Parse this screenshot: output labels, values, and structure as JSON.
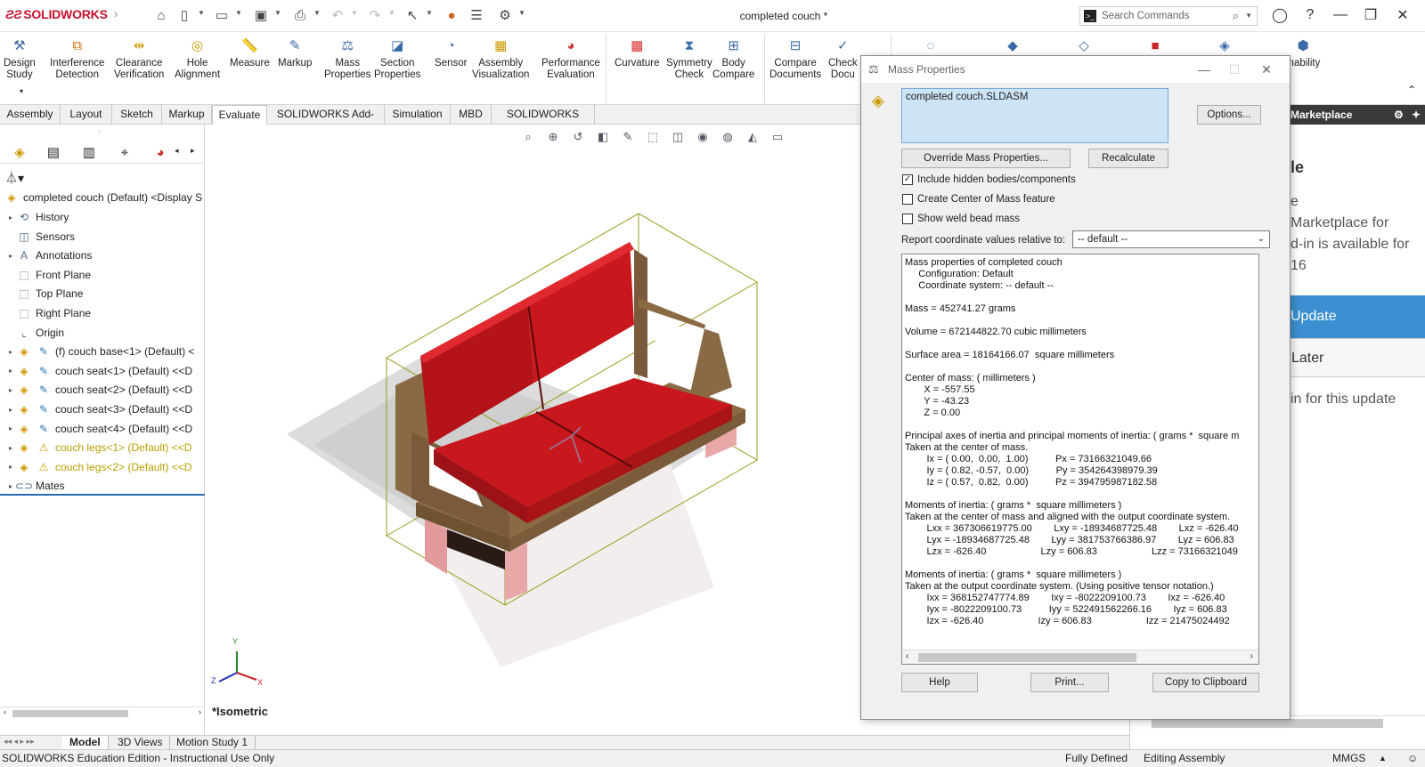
{
  "app": {
    "logo": "SOLIDWORKS",
    "doc_title": "completed couch *"
  },
  "search": {
    "placeholder": "Search Commands"
  },
  "toolbar": {
    "tools": [
      {
        "name": "design-study",
        "label": "Design\nStudy",
        "icon": "tool-icon"
      },
      {
        "name": "interference",
        "label": "Interference\nDetection",
        "icon": "interference-icon"
      },
      {
        "name": "clearance",
        "label": "Clearance\nVerification",
        "icon": "clearance-icon"
      },
      {
        "name": "hole-alignment",
        "label": "Hole\nAlignment",
        "icon": "hole-icon"
      },
      {
        "name": "measure",
        "label": "Measure",
        "icon": "measure-icon"
      },
      {
        "name": "markup",
        "label": "Markup",
        "icon": "markup-icon"
      },
      {
        "name": "mass-properties",
        "label": "Mass\nProperties",
        "icon": "scale-icon"
      },
      {
        "name": "section-properties",
        "label": "Section\nProperties",
        "icon": "section-icon"
      },
      {
        "name": "sensor",
        "label": "Sensor",
        "icon": "sensor-icon"
      },
      {
        "name": "assembly-visualization",
        "label": "Assembly\nVisualization",
        "icon": "assembly-icon"
      },
      {
        "name": "performance-evaluation",
        "label": "Performance\nEvaluation",
        "icon": "performance-icon"
      },
      {
        "name": "curvature",
        "label": "Curvature",
        "icon": "curvature-icon"
      },
      {
        "name": "symmetry-check",
        "label": "Symmetry\nCheck",
        "icon": "symmetry-icon"
      },
      {
        "name": "body-compare",
        "label": "Body\nCompare",
        "icon": "compare-icon"
      },
      {
        "name": "compare-documents",
        "label": "Compare\nDocuments",
        "icon": "documents-icon"
      },
      {
        "name": "check-documents",
        "label": "Check\nDocu",
        "icon": "check-icon"
      }
    ],
    "sustainability": "inability"
  },
  "tabs": [
    "Assembly",
    "Layout",
    "Sketch",
    "Markup",
    "Evaluate",
    "SOLIDWORKS Add-Ins",
    "Simulation",
    "MBD",
    "SOLIDWORKS CAM"
  ],
  "active_tab": "Evaluate",
  "tree": {
    "root": "completed couch (Default) <Display S",
    "items": [
      {
        "label": "History",
        "exp": true,
        "icon": "history-icon"
      },
      {
        "label": "Sensors",
        "exp": false,
        "icon": "sensors-icon"
      },
      {
        "label": "Annotations",
        "exp": true,
        "icon": "annotations-icon"
      },
      {
        "label": "Front Plane",
        "exp": false,
        "icon": "plane-icon"
      },
      {
        "label": "Top Plane",
        "exp": false,
        "icon": "plane-icon"
      },
      {
        "label": "Right Plane",
        "exp": false,
        "icon": "plane-icon"
      },
      {
        "label": "Origin",
        "exp": false,
        "icon": "origin-icon"
      },
      {
        "label": "(f) couch base<1> (Default) <",
        "exp": true,
        "icon": "part-icon",
        "warn": false
      },
      {
        "label": "couch seat<1> (Default) <<D",
        "exp": true,
        "icon": "part-icon",
        "warn": false
      },
      {
        "label": "couch seat<2> (Default) <<D",
        "exp": true,
        "icon": "part-icon",
        "warn": false
      },
      {
        "label": "couch seat<3> (Default) <<D",
        "exp": true,
        "icon": "part-icon",
        "warn": false
      },
      {
        "label": "couch seat<4> (Default) <<D",
        "exp": true,
        "icon": "part-icon",
        "warn": false
      },
      {
        "label": "couch legs<1> (Default) <<D",
        "exp": true,
        "icon": "warning-icon",
        "warn": true
      },
      {
        "label": "couch legs<2> (Default) <<D",
        "exp": true,
        "icon": "warning-icon",
        "warn": true
      },
      {
        "label": "Mates",
        "exp": true,
        "icon": "mates-icon"
      }
    ]
  },
  "viewport": {
    "view_label": "*Isometric",
    "triad": {
      "x": "X",
      "y": "Y",
      "z": "Z"
    }
  },
  "bottom_tabs": [
    "Model",
    "3D Views",
    "Motion Study 1"
  ],
  "status": {
    "edition": "SOLIDWORKS Education Edition - Instructional Use Only",
    "state": "Fully Defined",
    "mode": "Editing Assembly",
    "units": "MMGS"
  },
  "taskpane": {
    "title": "Marketplace",
    "lines": [
      "le",
      "e",
      "Marketplace for",
      "d-in is available for",
      "16"
    ],
    "update": "Update",
    "later": "Later",
    "footer": "in for this update"
  },
  "dialog": {
    "title": "Mass Properties",
    "selection": "completed couch.SLDASM",
    "options_btn": "Options...",
    "override_btn": "Override Mass Properties...",
    "recalculate_btn": "Recalculate",
    "checks": [
      {
        "label": "Include hidden bodies/components",
        "checked": "✓"
      },
      {
        "label": "Create Center of Mass feature",
        "checked": ""
      },
      {
        "label": "Show weld bead mass",
        "checked": ""
      }
    ],
    "coord_label": "Report coordinate values relative to:",
    "coord_value": "-- default --",
    "results": "Mass properties of completed couch\n     Configuration: Default\n     Coordinate system: -- default --\n\nMass = 452741.27 grams\n\nVolume = 672144822.70 cubic millimeters\n\nSurface area = 18164166.07  square millimeters\n\nCenter of mass: ( millimeters )\n       X = -557.55\n       Y = -43.23\n       Z = 0.00\n\nPrincipal axes of inertia and principal moments of inertia: ( grams *  square m\nTaken at the center of mass.\n        Ix = ( 0.00,  0.00,  1.00)          Px = 73166321049.66\n        Iy = ( 0.82, -0.57,  0.00)          Py = 354264398979.39\n        Iz = ( 0.57,  0.82,  0.00)          Pz = 394795987182.58\n\nMoments of inertia: ( grams *  square millimeters )\nTaken at the center of mass and aligned with the output coordinate system.\n        Lxx = 367306619775.00        Lxy = -18934687725.48        Lxz = -626.40\n        Lyx = -18934687725.48        Lyy = 381753766386.97        Lyz = 606.83\n        Lzx = -626.40                    Lzy = 606.83                    Lzz = 73166321049\n\nMoments of inertia: ( grams *  square millimeters )\nTaken at the output coordinate system. (Using positive tensor notation.)\n        Ixx = 368152747774.89        Ixy = -8022209100.73        Ixz = -626.40\n        Iyx = -8022209100.73          Iyy = 522491562266.16        Iyz = 606.83\n        Izx = -626.40                    Izy = 606.83                    Izz = 21475024492",
    "help_btn": "Help",
    "print_btn": "Print...",
    "copy_btn": "Copy to Clipboard"
  },
  "colors": {
    "accent": "#3b8fd0",
    "couch_red": "#c8171d",
    "couch_wood": "#8a6a45",
    "warn": "#b8a000"
  }
}
